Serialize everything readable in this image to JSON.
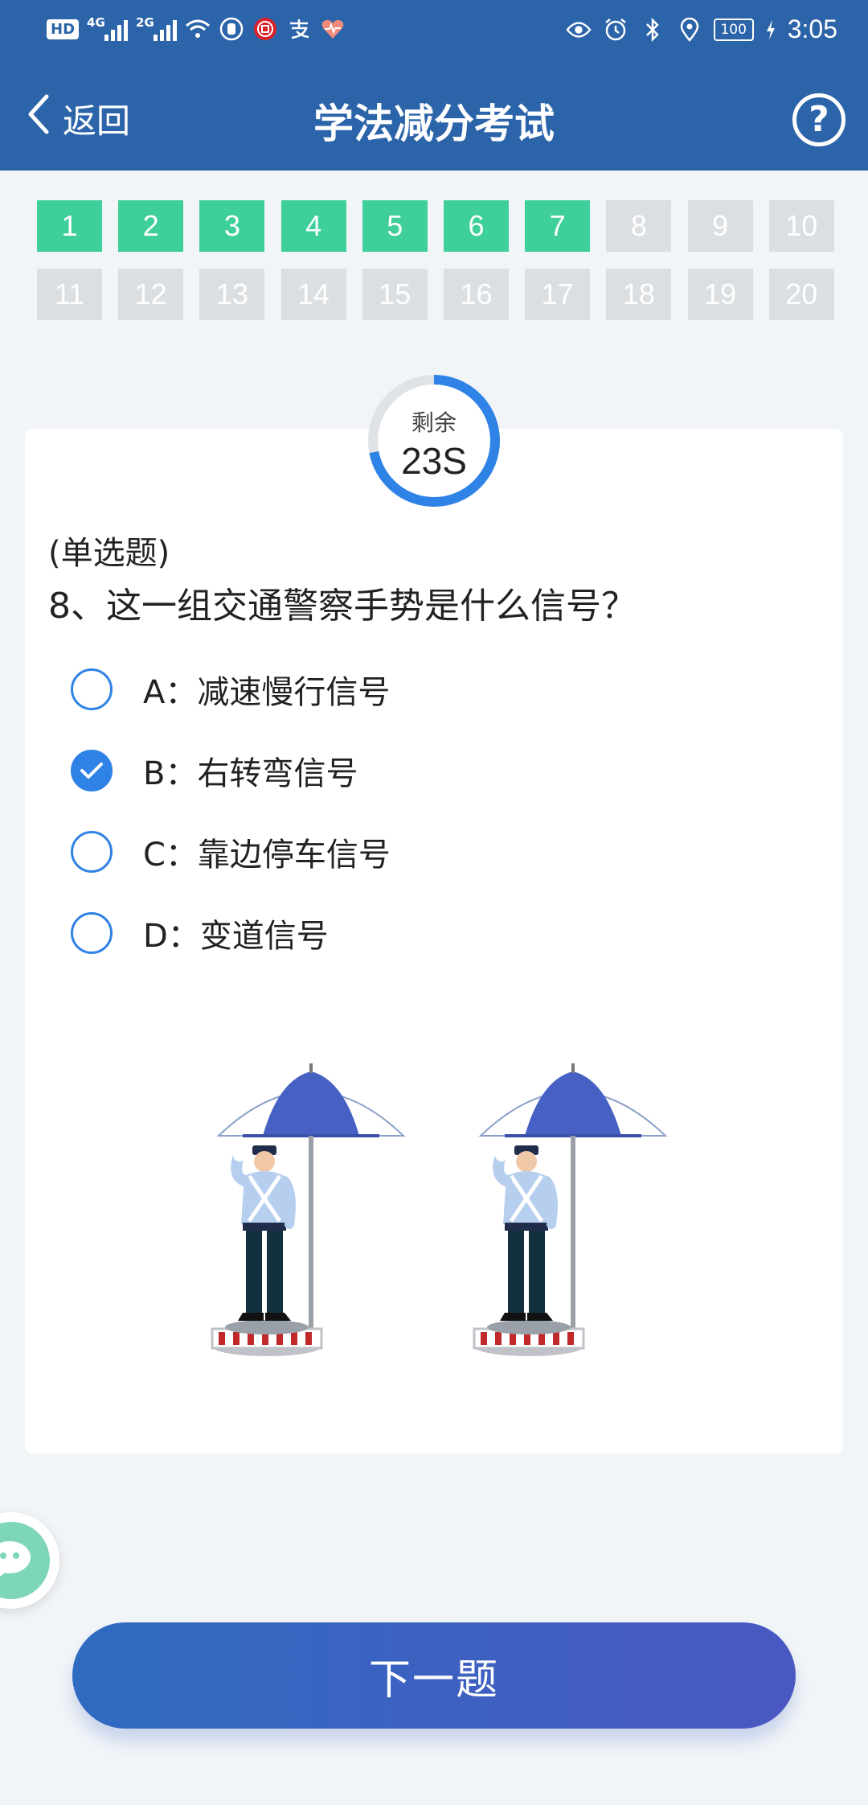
{
  "status_bar": {
    "hd": "HD",
    "net1": "4G",
    "net2": "2G",
    "battery": "100",
    "time": "3:05"
  },
  "nav": {
    "back_label": "返回",
    "title": "学法减分考试",
    "help_glyph": "?"
  },
  "grid": {
    "answered_color": "#3ecf9a",
    "unanswered_color": "#dcdfe2",
    "items": [
      {
        "n": "1",
        "answered": true
      },
      {
        "n": "2",
        "answered": true
      },
      {
        "n": "3",
        "answered": true
      },
      {
        "n": "4",
        "answered": true
      },
      {
        "n": "5",
        "answered": true
      },
      {
        "n": "6",
        "answered": true
      },
      {
        "n": "7",
        "answered": true
      },
      {
        "n": "8",
        "answered": false
      },
      {
        "n": "9",
        "answered": false
      },
      {
        "n": "10",
        "answered": false
      },
      {
        "n": "11",
        "answered": false
      },
      {
        "n": "12",
        "answered": false
      },
      {
        "n": "13",
        "answered": false
      },
      {
        "n": "14",
        "answered": false
      },
      {
        "n": "15",
        "answered": false
      },
      {
        "n": "16",
        "answered": false
      },
      {
        "n": "17",
        "answered": false
      },
      {
        "n": "18",
        "answered": false
      },
      {
        "n": "19",
        "answered": false
      },
      {
        "n": "20",
        "answered": false
      }
    ]
  },
  "timer": {
    "label": "剩余",
    "value": "23S",
    "remaining_fraction": 0.72,
    "accent": "#2f82e6"
  },
  "question": {
    "type": "(单选题)",
    "text": "8、这一组交通警察手势是什么信号？",
    "options": [
      {
        "key": "A",
        "label": "A：减速慢行信号",
        "checked": false
      },
      {
        "key": "B",
        "label": "B：右转弯信号",
        "checked": true
      },
      {
        "key": "C",
        "label": "C：靠边停车信号",
        "checked": false
      },
      {
        "key": "D",
        "label": "D：变道信号",
        "checked": false
      }
    ]
  },
  "footer": {
    "next_label": "下一题"
  },
  "icons": {
    "back": "chevron-left-icon",
    "help": "question-circle-icon",
    "chat": "wechat-icon"
  }
}
